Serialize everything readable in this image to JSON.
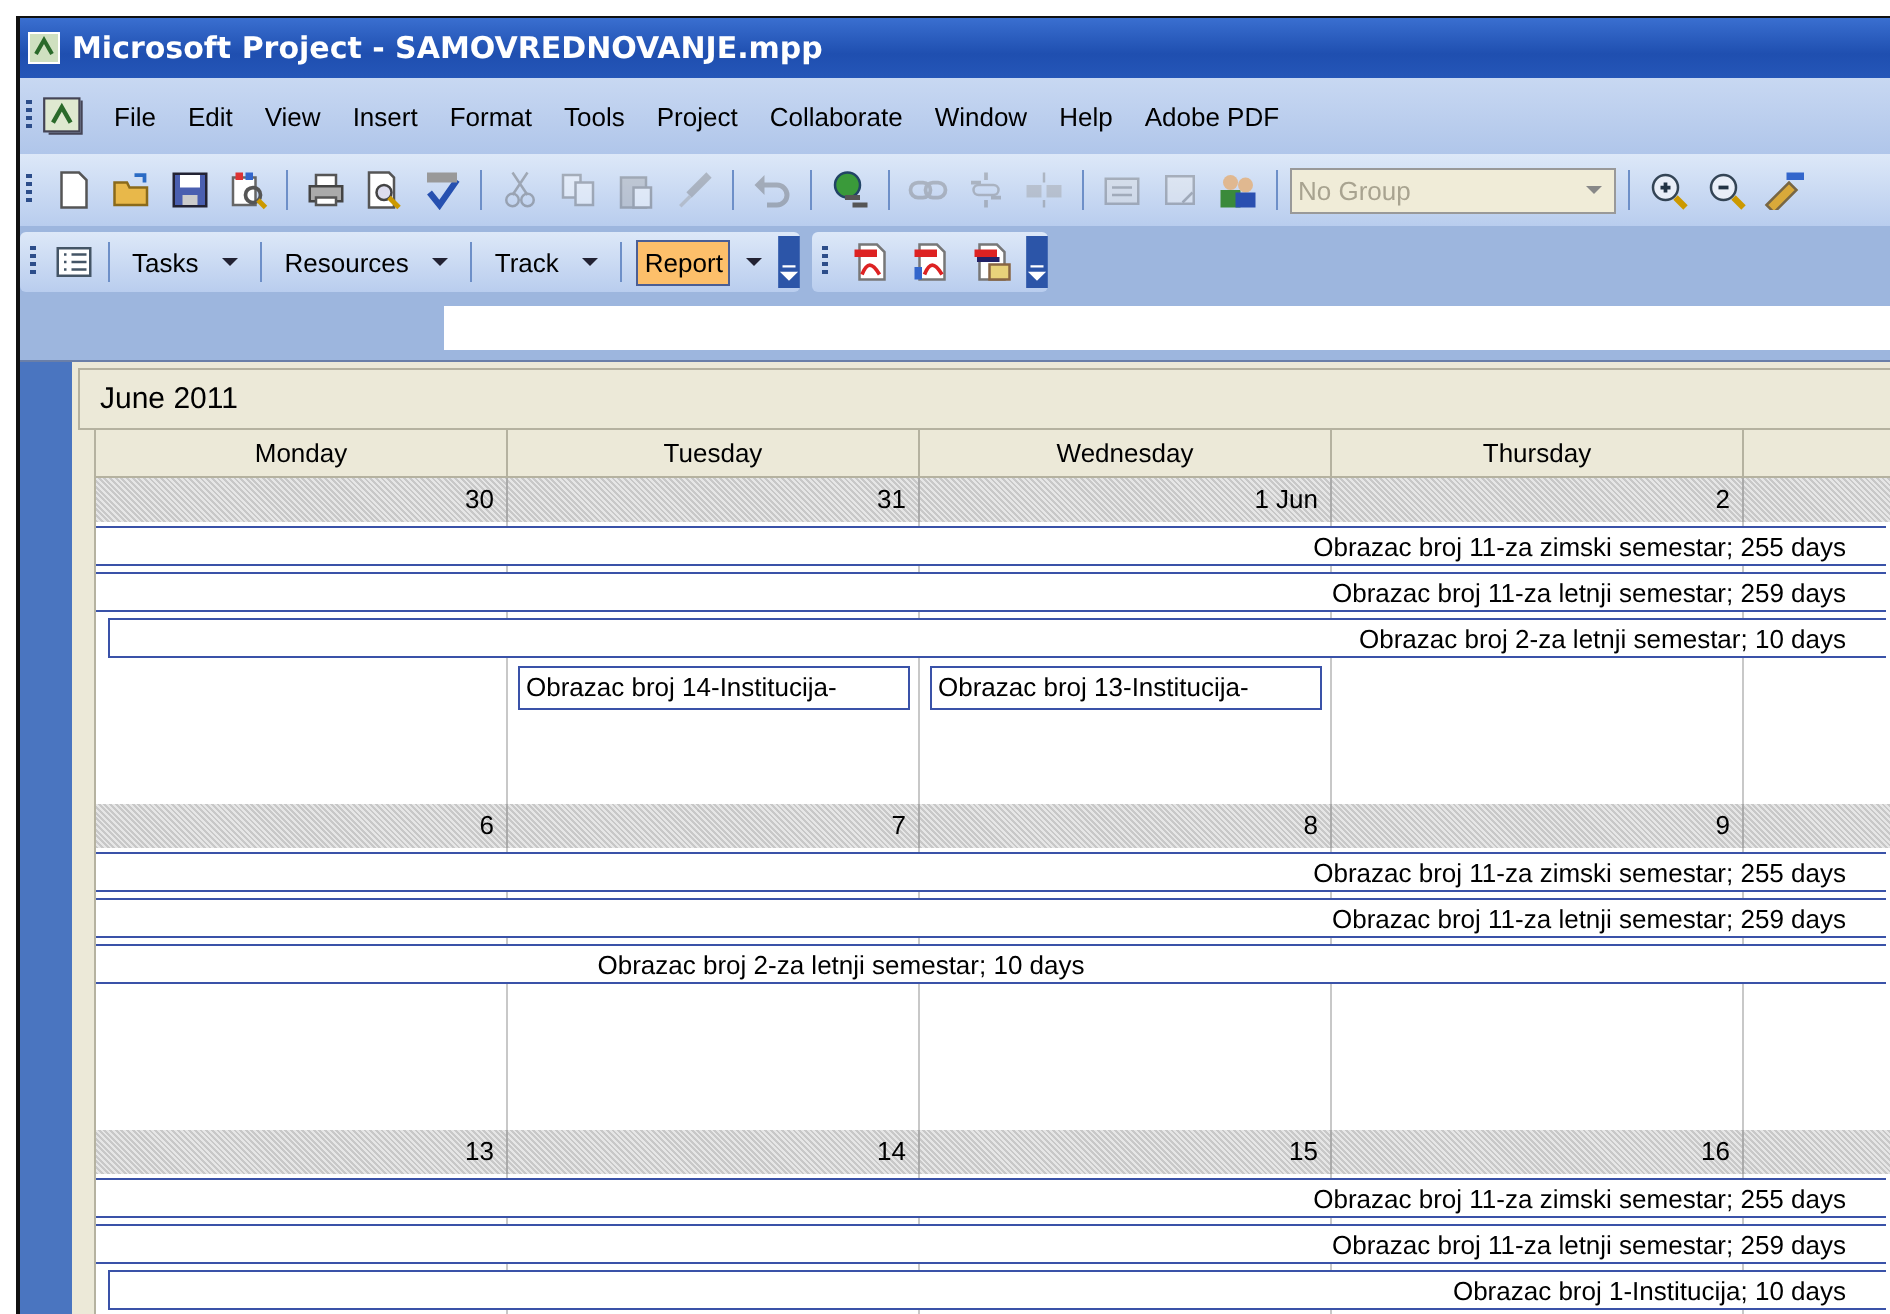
{
  "window": {
    "title": "Microsoft Project - SAMOVREDNOVANJE.mpp"
  },
  "menu": [
    "File",
    "Edit",
    "View",
    "Insert",
    "Format",
    "Tools",
    "Project",
    "Collaborate",
    "Window",
    "Help",
    "Adobe PDF"
  ],
  "standard_toolbar": {
    "groups": [
      [
        {
          "kind": "new",
          "disabled": false
        },
        {
          "kind": "open",
          "disabled": false
        },
        {
          "kind": "save",
          "disabled": false
        },
        {
          "kind": "picture",
          "disabled": false
        }
      ],
      [
        {
          "kind": "print",
          "disabled": false
        },
        {
          "kind": "preview",
          "disabled": false
        },
        {
          "kind": "spelling",
          "disabled": false
        }
      ],
      [
        {
          "kind": "cut",
          "disabled": true
        },
        {
          "kind": "copy",
          "disabled": true
        },
        {
          "kind": "paste",
          "disabled": true
        },
        {
          "kind": "painter",
          "disabled": true
        }
      ],
      [
        {
          "kind": "undo",
          "disabled": true
        }
      ],
      [
        {
          "kind": "hyperlink",
          "disabled": false
        }
      ],
      [
        {
          "kind": "link",
          "disabled": true
        },
        {
          "kind": "unlink",
          "disabled": true
        },
        {
          "kind": "split",
          "disabled": true
        }
      ],
      [
        {
          "kind": "info",
          "disabled": true
        },
        {
          "kind": "notes",
          "disabled": true
        },
        {
          "kind": "resources",
          "disabled": false
        }
      ]
    ],
    "group_by": {
      "value": "No Group",
      "disabled": true
    },
    "after": [
      {
        "kind": "zoom-in",
        "disabled": false
      },
      {
        "kind": "zoom-out",
        "disabled": false
      },
      {
        "kind": "wizard",
        "disabled": false
      }
    ]
  },
  "guide_toolbar": {
    "buttons": [
      {
        "label": "Tasks",
        "selected": false
      },
      {
        "label": "Resources",
        "selected": false
      },
      {
        "label": "Track",
        "selected": false
      },
      {
        "label": "Report",
        "selected": true
      }
    ]
  },
  "pdf_toolbar": {
    "icons": [
      {
        "kind": "pdf"
      },
      {
        "kind": "pdf-doc"
      },
      {
        "kind": "pdf-mail"
      }
    ]
  },
  "calendar": {
    "month": "June 2011",
    "weekdays": [
      "Monday",
      "Tuesday",
      "Wednesday",
      "Thursday"
    ],
    "weeks": [
      {
        "days": [
          {
            "date": "30"
          },
          {
            "date": "31",
            "tasks": [
              "Obrazac broj 14-Institucija-"
            ]
          },
          {
            "date": "1 Jun",
            "tasks": [
              "Obrazac broj 13-Institucija-"
            ]
          },
          {
            "date": "2"
          }
        ],
        "bars": [
          {
            "label": "Obrazac broj 11-za zimski semestar; 255 days",
            "kind": "long",
            "starts_in_view": false
          },
          {
            "label": "Obrazac broj 11-za letnji semestar; 259 days",
            "kind": "long",
            "starts_in_view": false
          },
          {
            "label": "Obrazac broj 2-za letnji semestar; 10 days",
            "kind": "long",
            "starts_in_view": true
          }
        ]
      },
      {
        "days": [
          {
            "date": "6"
          },
          {
            "date": "7"
          },
          {
            "date": "8"
          },
          {
            "date": "9"
          }
        ],
        "bars": [
          {
            "label": "Obrazac broj 11-za zimski semestar; 255 days",
            "kind": "long",
            "starts_in_view": false
          },
          {
            "label": "Obrazac broj 11-za letnji semestar; 259 days",
            "kind": "long",
            "starts_in_view": false
          },
          {
            "label": "Obrazac broj 2-za letnji semestar; 10 days",
            "kind": "short",
            "starts_in_view": false
          }
        ]
      },
      {
        "days": [
          {
            "date": "13"
          },
          {
            "date": "14"
          },
          {
            "date": "15"
          },
          {
            "date": "16"
          }
        ],
        "bars": [
          {
            "label": "Obrazac broj 11-za zimski semestar; 255 days",
            "kind": "long",
            "starts_in_view": false
          },
          {
            "label": "Obrazac broj 11-za letnji semestar; 259 days",
            "kind": "long",
            "starts_in_view": false
          },
          {
            "label": "Obrazac broj 1-Institucija; 10 days",
            "kind": "long",
            "starts_in_view": true
          }
        ]
      }
    ]
  }
}
